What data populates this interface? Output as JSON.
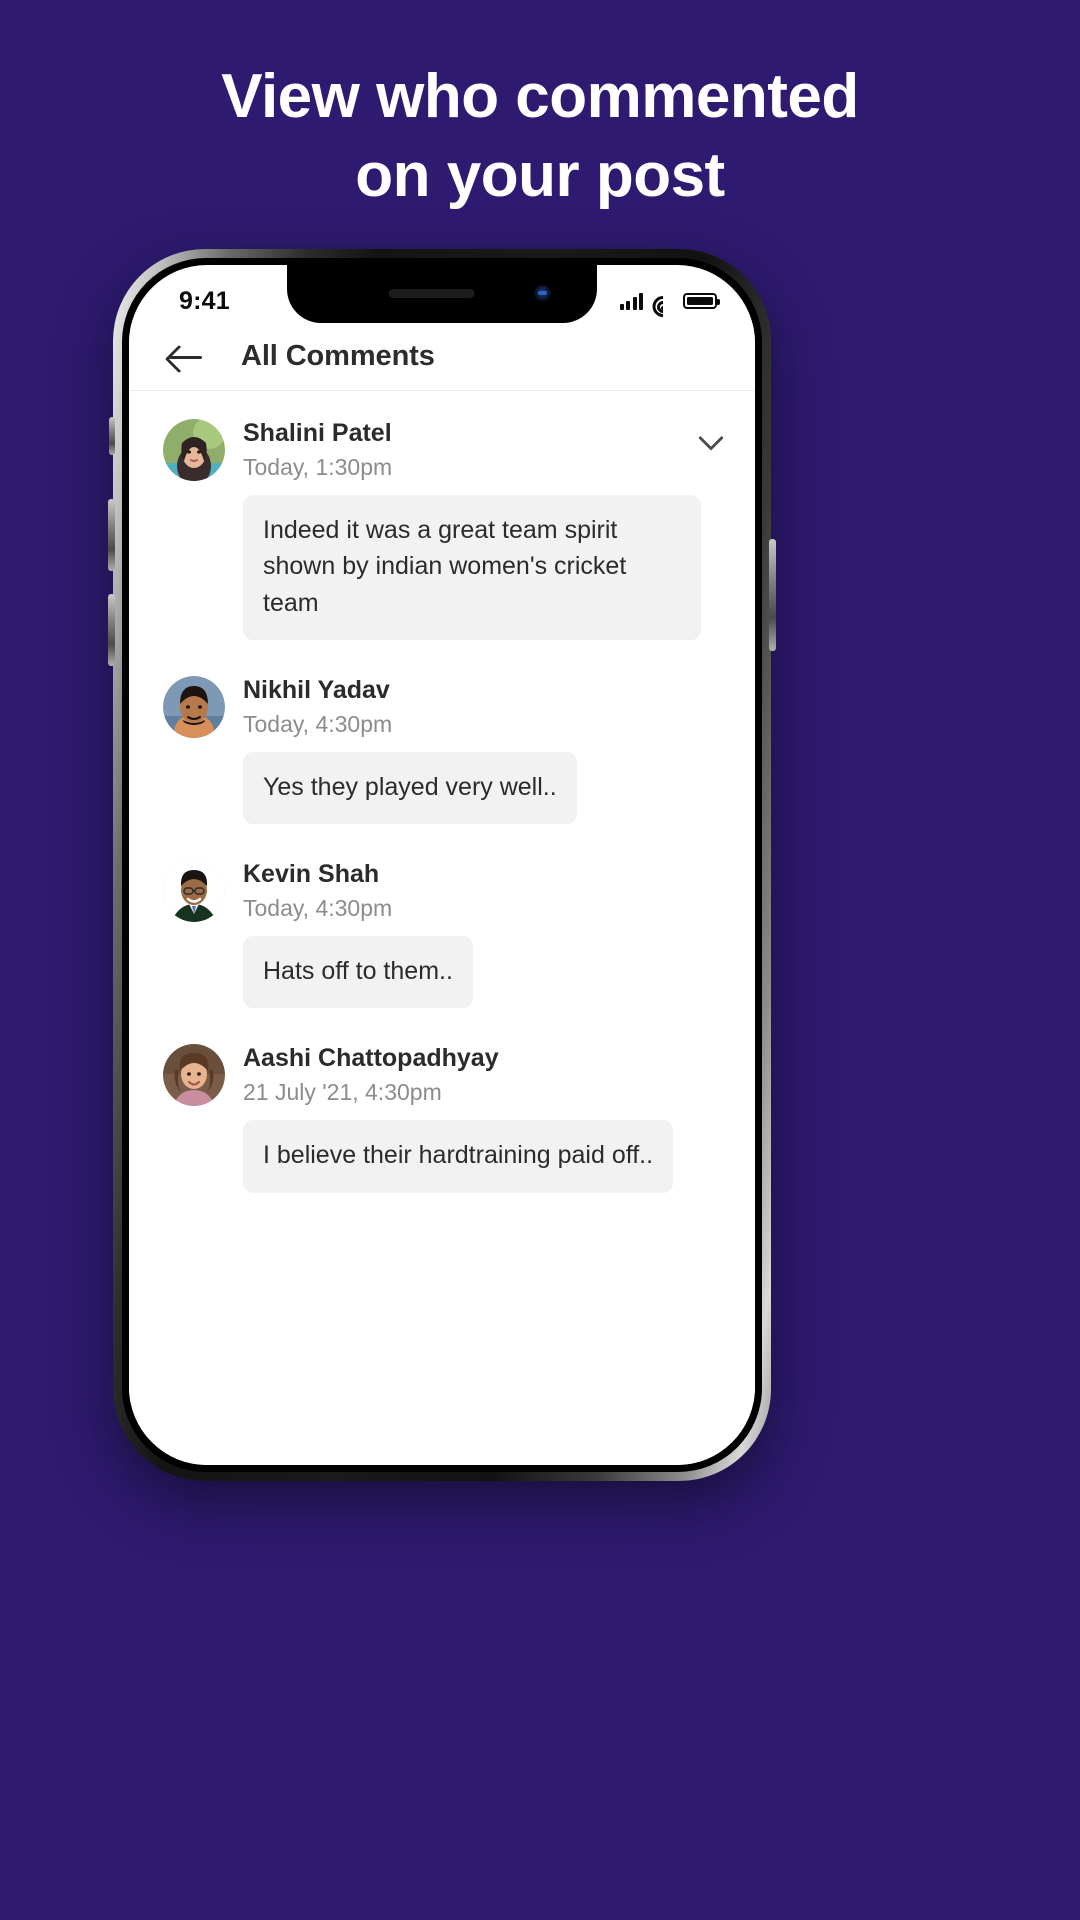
{
  "promo": {
    "headline_line1": "View who commented",
    "headline_line2": "on your post",
    "background_color": "#2E1A70",
    "text_color": "#FFFFFF"
  },
  "status_bar": {
    "time": "9:41",
    "signal_icon": "signal-bars-icon",
    "wifi_icon": "wifi-icon",
    "battery_icon": "battery-full-icon"
  },
  "app_header": {
    "back_icon": "arrow-left-icon",
    "title": "All Comments"
  },
  "comments": [
    {
      "name": "Shalini Patel",
      "time": "Today, 1:30pm",
      "text": "Indeed it was a great team spirit shown by indian women's cricket team",
      "has_chevron": true,
      "chevron_icon": "chevron-down-icon",
      "avatar": "avatar-shalini-patel"
    },
    {
      "name": "Nikhil Yadav",
      "time": "Today, 4:30pm",
      "text": "Yes they played very well..",
      "has_chevron": false,
      "avatar": "avatar-nikhil-yadav"
    },
    {
      "name": "Kevin Shah",
      "time": "Today, 4:30pm",
      "text": "Hats off to them..",
      "has_chevron": false,
      "avatar": "avatar-kevin-shah"
    },
    {
      "name": "Aashi Chattopadhyay",
      "time": "21 July '21, 4:30pm",
      "text": "I believe their hardtraining paid off..",
      "has_chevron": false,
      "avatar": "avatar-aashi-chattopadhyay"
    }
  ],
  "theme": {
    "bubble_bg": "#F2F2F3",
    "name_color": "#2B2B2B",
    "time_color": "#8C8C8C"
  }
}
